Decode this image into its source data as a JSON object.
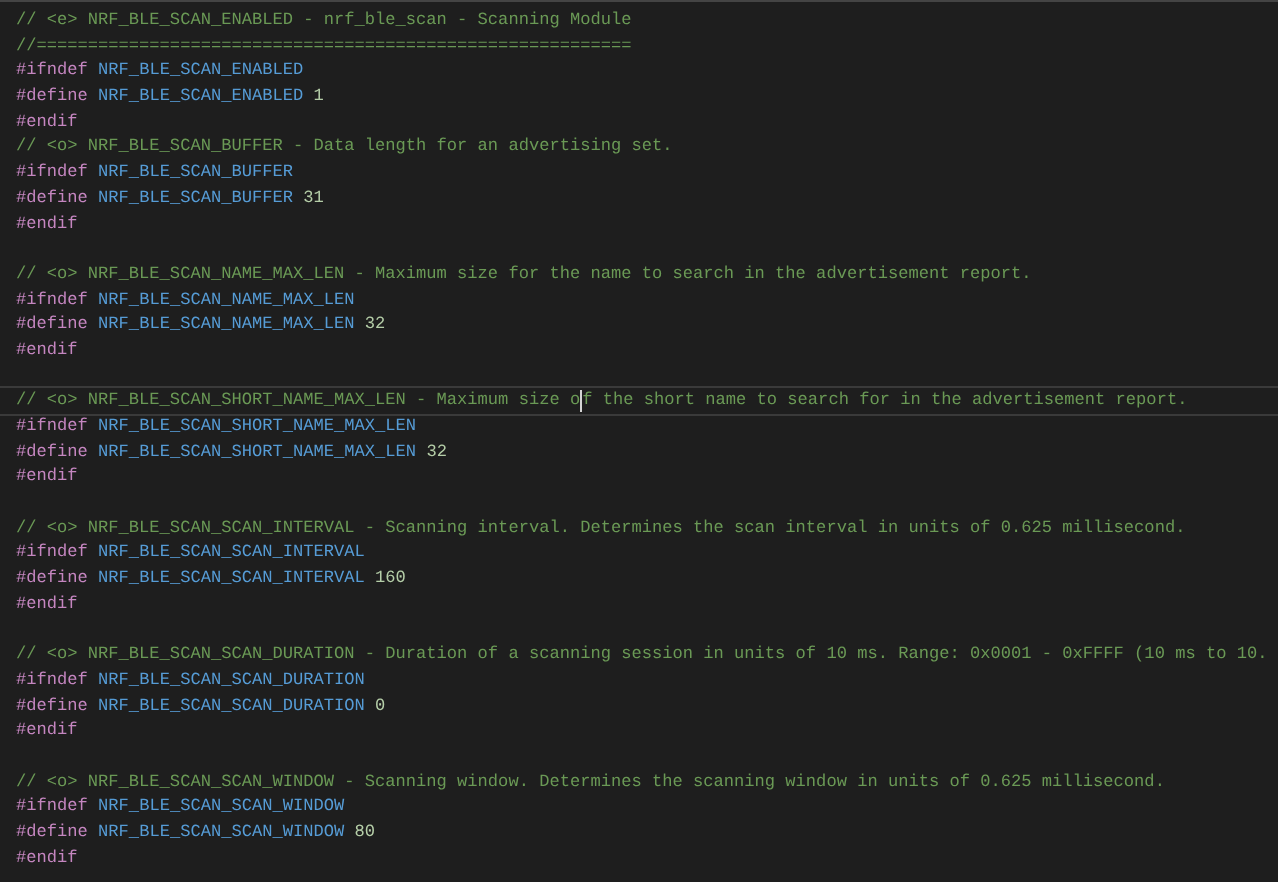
{
  "lines": [
    {
      "kind": "comment",
      "text": "// <e> NRF_BLE_SCAN_ENABLED - nrf_ble_scan - Scanning Module",
      "current": false
    },
    {
      "kind": "comment",
      "text": "//==========================================================",
      "current": false
    },
    {
      "kind": "ifndef",
      "directive": "#ifndef",
      "name": "NRF_BLE_SCAN_ENABLED",
      "current": false
    },
    {
      "kind": "define",
      "directive": "#define",
      "name": "NRF_BLE_SCAN_ENABLED",
      "value": "1",
      "current": false
    },
    {
      "kind": "endif",
      "directive": "#endif",
      "current": false
    },
    {
      "kind": "comment",
      "text": "// <o> NRF_BLE_SCAN_BUFFER - Data length for an advertising set.",
      "current": false
    },
    {
      "kind": "ifndef",
      "directive": "#ifndef",
      "name": "NRF_BLE_SCAN_BUFFER",
      "current": false
    },
    {
      "kind": "define",
      "directive": "#define",
      "name": "NRF_BLE_SCAN_BUFFER",
      "value": "31",
      "current": false
    },
    {
      "kind": "endif",
      "directive": "#endif",
      "current": false
    },
    {
      "kind": "blank",
      "current": false
    },
    {
      "kind": "comment",
      "text": "// <o> NRF_BLE_SCAN_NAME_MAX_LEN - Maximum size for the name to search in the advertisement report.",
      "current": false
    },
    {
      "kind": "ifndef",
      "directive": "#ifndef",
      "name": "NRF_BLE_SCAN_NAME_MAX_LEN",
      "current": false
    },
    {
      "kind": "define",
      "directive": "#define",
      "name": "NRF_BLE_SCAN_NAME_MAX_LEN",
      "value": "32",
      "current": false
    },
    {
      "kind": "endif",
      "directive": "#endif",
      "current": false
    },
    {
      "kind": "blank",
      "current": false
    },
    {
      "kind": "comment",
      "text": "// <o> NRF_BLE_SCAN_SHORT_NAME_MAX_LEN - Maximum size o",
      "text_after_cursor": "f the short name to search for in the advertisement report.",
      "current": true
    },
    {
      "kind": "ifndef",
      "directive": "#ifndef",
      "name": "NRF_BLE_SCAN_SHORT_NAME_MAX_LEN",
      "current": false
    },
    {
      "kind": "define",
      "directive": "#define",
      "name": "NRF_BLE_SCAN_SHORT_NAME_MAX_LEN",
      "value": "32",
      "current": false
    },
    {
      "kind": "endif",
      "directive": "#endif",
      "current": false
    },
    {
      "kind": "blank",
      "current": false
    },
    {
      "kind": "comment",
      "text": "// <o> NRF_BLE_SCAN_SCAN_INTERVAL - Scanning interval. Determines the scan interval in units of 0.625 millisecond.",
      "current": false
    },
    {
      "kind": "ifndef",
      "directive": "#ifndef",
      "name": "NRF_BLE_SCAN_SCAN_INTERVAL",
      "current": false
    },
    {
      "kind": "define",
      "directive": "#define",
      "name": "NRF_BLE_SCAN_SCAN_INTERVAL",
      "value": "160",
      "current": false
    },
    {
      "kind": "endif",
      "directive": "#endif",
      "current": false
    },
    {
      "kind": "blank",
      "current": false
    },
    {
      "kind": "comment",
      "text": "// <o> NRF_BLE_SCAN_SCAN_DURATION - Duration of a scanning session in units of 10 ms. Range: 0x0001 - 0xFFFF (10 ms to 10.",
      "current": false
    },
    {
      "kind": "ifndef",
      "directive": "#ifndef",
      "name": "NRF_BLE_SCAN_SCAN_DURATION",
      "current": false
    },
    {
      "kind": "define",
      "directive": "#define",
      "name": "NRF_BLE_SCAN_SCAN_DURATION",
      "value": "0",
      "current": false
    },
    {
      "kind": "endif",
      "directive": "#endif",
      "current": false
    },
    {
      "kind": "blank",
      "current": false
    },
    {
      "kind": "comment",
      "text": "// <o> NRF_BLE_SCAN_SCAN_WINDOW - Scanning window. Determines the scanning window in units of 0.625 millisecond.",
      "current": false
    },
    {
      "kind": "ifndef",
      "directive": "#ifndef",
      "name": "NRF_BLE_SCAN_SCAN_WINDOW",
      "current": false
    },
    {
      "kind": "define",
      "directive": "#define",
      "name": "NRF_BLE_SCAN_SCAN_WINDOW",
      "value": "80",
      "current": false
    },
    {
      "kind": "endif",
      "directive": "#endif",
      "current": false
    }
  ]
}
